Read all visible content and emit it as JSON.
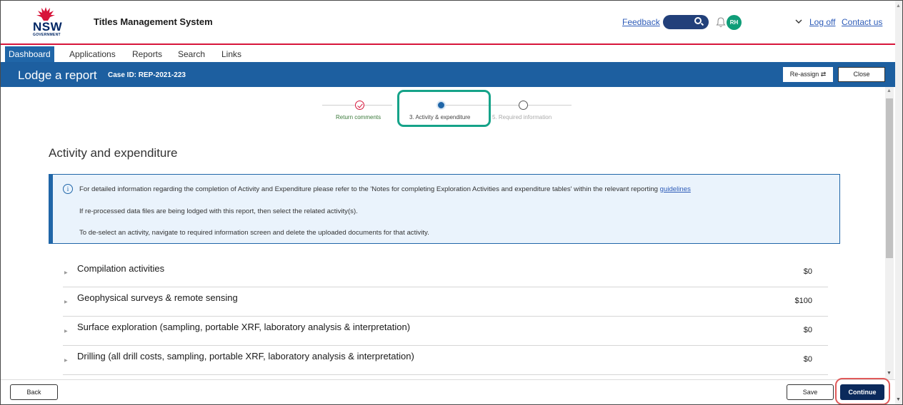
{
  "header": {
    "logo_text": "NSW",
    "logo_subtext": "GOVERNMENT",
    "app_title": "Titles Management System",
    "feedback_link": "Feedback",
    "avatar_initials": "RH",
    "logoff_link": "Log off",
    "contact_link": "Contact us"
  },
  "nav": {
    "items": [
      {
        "label": "Dashboard",
        "active": true
      },
      {
        "label": "Applications",
        "active": false
      },
      {
        "label": "Reports",
        "active": false
      },
      {
        "label": "Search",
        "active": false
      },
      {
        "label": "Links",
        "active": false
      }
    ]
  },
  "lodge_bar": {
    "title": "Lodge a report",
    "case_id": "Case ID: REP-2021-223",
    "reassign_label": "Re-assign ⇄",
    "close_label": "Close"
  },
  "stepper": {
    "steps": [
      {
        "label": "Return comments",
        "state": "done"
      },
      {
        "label": "3. Activity & expenditure",
        "state": "current"
      },
      {
        "label": "5. Required information",
        "state": "todo"
      }
    ]
  },
  "main": {
    "section_title": "Activity and expenditure",
    "info": {
      "line1_text": "For detailed information regarding the completion of Activity and Expenditure please refer to the 'Notes for completing Exploration Activities and expenditure tables' within the relevant reporting",
      "line1_link": "guidelines",
      "line2": "If re-processed data files are being lodged with this report, then select the related activity(s).",
      "line3": "To de-select an activity, navigate to required information screen and delete the uploaded documents for that activity."
    },
    "activities": [
      {
        "label": "Compilation activities",
        "amount": "$0"
      },
      {
        "label": "Geophysical surveys & remote sensing",
        "amount": "$100"
      },
      {
        "label": "Surface exploration (sampling, portable XRF, laboratory analysis & interpretation)",
        "amount": "$0"
      },
      {
        "label": "Drilling (all drill costs, sampling, portable XRF, laboratory analysis & interpretation)",
        "amount": "$0"
      }
    ]
  },
  "footer": {
    "back_label": "Back",
    "save_label": "Save",
    "continue_label": "Continue"
  },
  "colors": {
    "nsw_red": "#d7153a",
    "brand_blue": "#1d5fa0",
    "navy": "#0b2a5c",
    "highlight_teal": "#16a389",
    "highlight_red": "#e05a5a"
  }
}
